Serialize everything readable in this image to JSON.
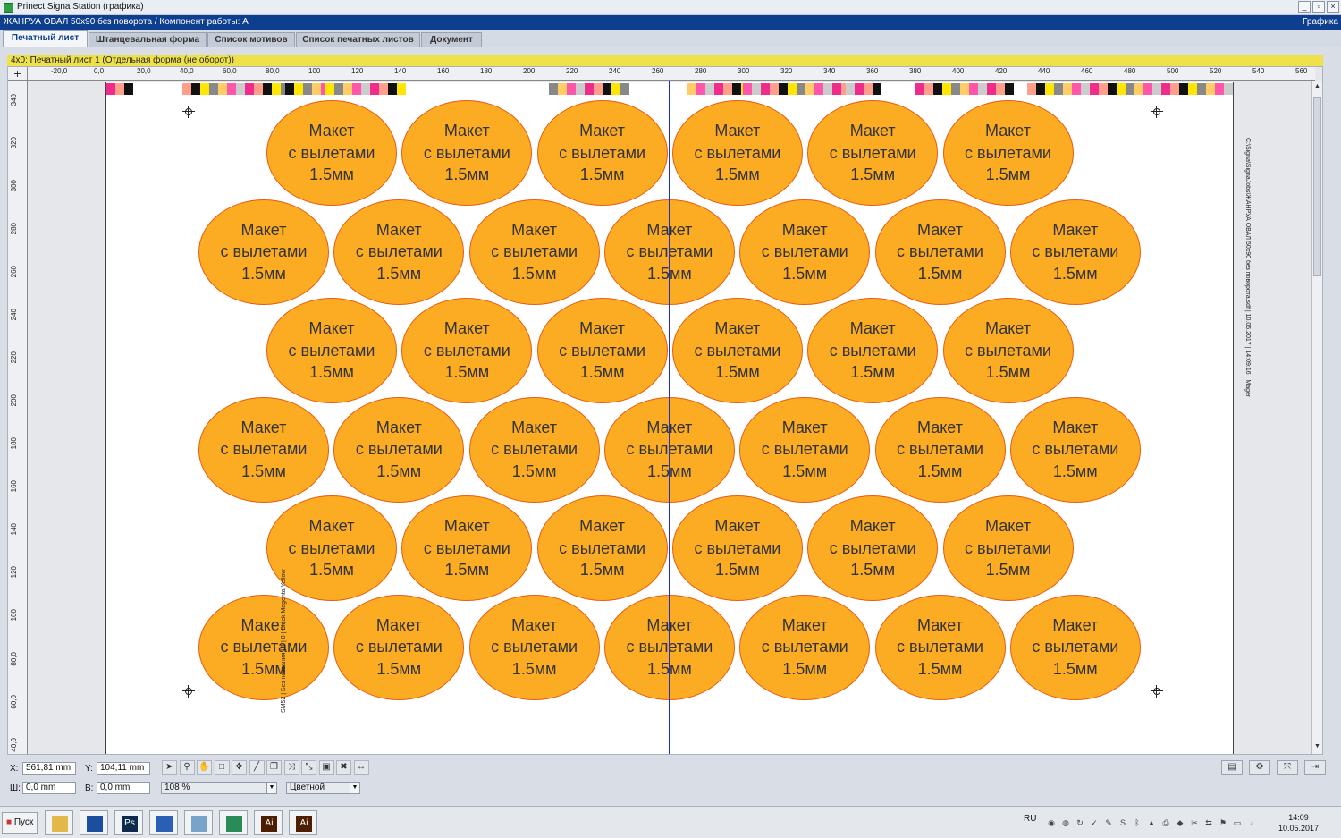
{
  "window": {
    "title": "Prinect Signa Station (графика)",
    "path": "ЖАНРУА ОВАЛ 50x90 без поворота / Компонент работы: A",
    "mode": "Графика",
    "buttons": [
      "_",
      "▫",
      "×"
    ]
  },
  "tabs": [
    {
      "label": "Печатный лист",
      "active": true
    },
    {
      "label": "Штанцевальная форма",
      "active": false
    },
    {
      "label": "Список мотивов",
      "active": false
    },
    {
      "label": "Список печатных листов",
      "active": false
    },
    {
      "label": "Документ",
      "active": false
    }
  ],
  "info_strip": "4x0:  Печатный лист 1 (Отдельная форма (не оборот))",
  "ruler_corner": "+",
  "ruler_h": [
    "-20,0",
    "0,0",
    "20,0",
    "40,0",
    "60,0",
    "80,0",
    "100",
    "120",
    "140",
    "160",
    "180",
    "200",
    "220",
    "240",
    "260",
    "280",
    "300",
    "320",
    "340",
    "360",
    "380",
    "400",
    "420",
    "440",
    "460",
    "480",
    "500",
    "520",
    "540",
    "560"
  ],
  "ruler_v": [
    "340",
    "320",
    "300",
    "280",
    "260",
    "240",
    "220",
    "200",
    "180",
    "160",
    "140",
    "120",
    "100",
    "80,0",
    "60,0",
    "40,0"
  ],
  "oval_text": {
    "line1": "Макет",
    "line2": "с вылетами",
    "line3": "1.5мм"
  },
  "ovals_rows": [
    6,
    7,
    6,
    7,
    6,
    7
  ],
  "side_text_right": "C:\\Signa\\SignaJobs\\ЖАНРУА ОВАЛ 50x90 без поворота.sdf | 10.05.2017 | 14:09:16 | Magenta",
  "side_text_left": "SM52 | Без названия | 1 | 0 | Black Magenta Yellow",
  "colors": {
    "oval_fill": "#fcac22",
    "oval_stroke": "#e85a0f",
    "guide": "#1d2fd6",
    "info_strip": "#efe14a",
    "path_bar": "#0e3e8e"
  },
  "status": {
    "x_label": "X:",
    "x_value": "561,81 mm",
    "y_label": "Y:",
    "y_value": "104,11 mm",
    "w_label": "Ш:",
    "w_value": "0,0 mm",
    "h_label": "В:",
    "h_value": "0,0 mm",
    "zoom": "108 %",
    "color_mode": "Цветной"
  },
  "tools": [
    "arrow-icon",
    "zoom-icon",
    "hand-icon",
    "select-rect-icon",
    "move-icon",
    "line-icon",
    "copy-icon",
    "transform-icon",
    "scale-icon",
    "fill-icon",
    "delete-icon",
    "measure-icon"
  ],
  "taskbar": {
    "start": "Пуск",
    "apps": [
      {
        "name": "explorer",
        "label": "",
        "color": "#e0b94a"
      },
      {
        "name": "app-blue",
        "label": "",
        "color": "#1b4f9e"
      },
      {
        "name": "photoshop",
        "label": "Ps",
        "color": "#0d2a4f"
      },
      {
        "name": "browser",
        "label": "",
        "color": "#2a5fb5"
      },
      {
        "name": "notes",
        "label": "",
        "color": "#7aa3c9"
      },
      {
        "name": "signa",
        "label": "",
        "color": "#2b8b58"
      },
      {
        "name": "illustrator-1",
        "label": "Ai",
        "color": "#4b1f00"
      },
      {
        "name": "illustrator-2",
        "label": "Ai",
        "color": "#4b1f00"
      }
    ],
    "lang": "RU",
    "time": "14:09",
    "date": "10.05.2017"
  }
}
